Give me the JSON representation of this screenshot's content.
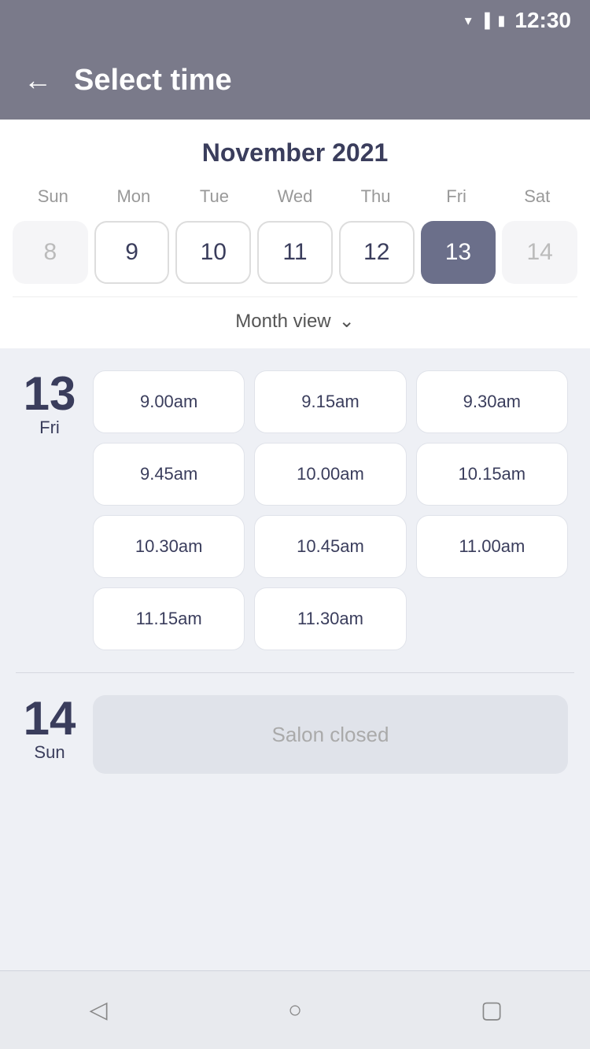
{
  "statusBar": {
    "time": "12:30"
  },
  "header": {
    "title": "Select time",
    "backLabel": "←"
  },
  "calendar": {
    "monthTitle": "November 2021",
    "dayHeaders": [
      "Sun",
      "Mon",
      "Tue",
      "Wed",
      "Thu",
      "Fri",
      "Sat"
    ],
    "dates": [
      {
        "value": "8",
        "state": "dimmed"
      },
      {
        "value": "9",
        "state": "bordered"
      },
      {
        "value": "10",
        "state": "bordered"
      },
      {
        "value": "11",
        "state": "bordered"
      },
      {
        "value": "12",
        "state": "bordered"
      },
      {
        "value": "13",
        "state": "selected"
      },
      {
        "value": "14",
        "state": "dimmed"
      }
    ],
    "monthViewLabel": "Month view",
    "chevron": "⌄"
  },
  "days": [
    {
      "number": "13",
      "name": "Fri",
      "slots": [
        "9.00am",
        "9.15am",
        "9.30am",
        "9.45am",
        "10.00am",
        "10.15am",
        "10.30am",
        "10.45am",
        "11.00am",
        "11.15am",
        "11.30am"
      ]
    },
    {
      "number": "14",
      "name": "Sun",
      "slots": [],
      "closed": true,
      "closedLabel": "Salon closed"
    }
  ],
  "bottomNav": {
    "backIcon": "◁",
    "homeIcon": "○",
    "recentIcon": "▢"
  }
}
